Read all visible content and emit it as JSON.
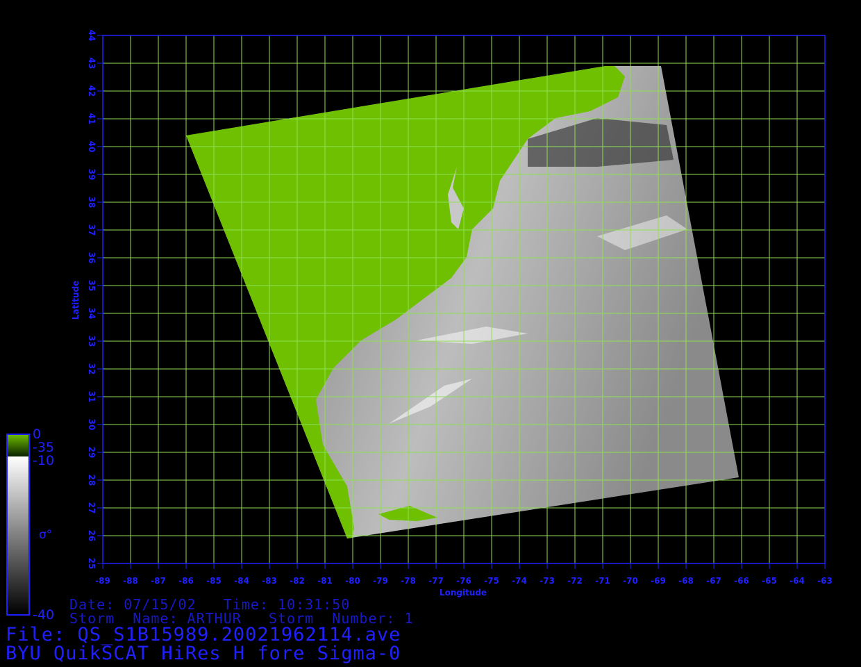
{
  "colors": {
    "background": "#000000",
    "grid": "#8ee05a",
    "axis": "#2020ff",
    "land": "#6ec000"
  },
  "axes": {
    "xlabel": "Longitude",
    "ylabel": "Latitude",
    "lon_range": [
      -89,
      -63
    ],
    "lat_range": [
      25,
      44
    ],
    "lon_ticks": [
      "-89",
      "-88",
      "-87",
      "-86",
      "-85",
      "-84",
      "-83",
      "-82",
      "-81",
      "-80",
      "-79",
      "-78",
      "-77",
      "-76",
      "-75",
      "-74",
      "-73",
      "-72",
      "-71",
      "-70",
      "-69",
      "-68",
      "-67",
      "-66",
      "-65",
      "-64",
      "-63"
    ],
    "lat_ticks": [
      "25",
      "26",
      "27",
      "28",
      "29",
      "30",
      "31",
      "32",
      "33",
      "34",
      "35",
      "36",
      "37",
      "38",
      "39",
      "40",
      "41",
      "42",
      "43",
      "44"
    ]
  },
  "swath": {
    "corners_lonlat": [
      [
        -86.0,
        40.4
      ],
      [
        -70.9,
        42.9
      ],
      [
        -68.9,
        42.9
      ],
      [
        -66.1,
        28.1
      ],
      [
        -80.2,
        25.9
      ]
    ]
  },
  "colorbar": {
    "land_top": "0",
    "land_bottom": "-35",
    "ocean_top": "-10",
    "ocean_bottom": "-40",
    "symbol": "σ°"
  },
  "info": {
    "date_time": "Date: 07/15/02   Time: 10:31:50",
    "storm": "Storm  Name: ARTHUR   Storm  Number: 1",
    "file": "File: QS_S1B15989.20021962114.ave",
    "product": "BYU QuikSCAT HiRes H fore Sigma-0"
  }
}
